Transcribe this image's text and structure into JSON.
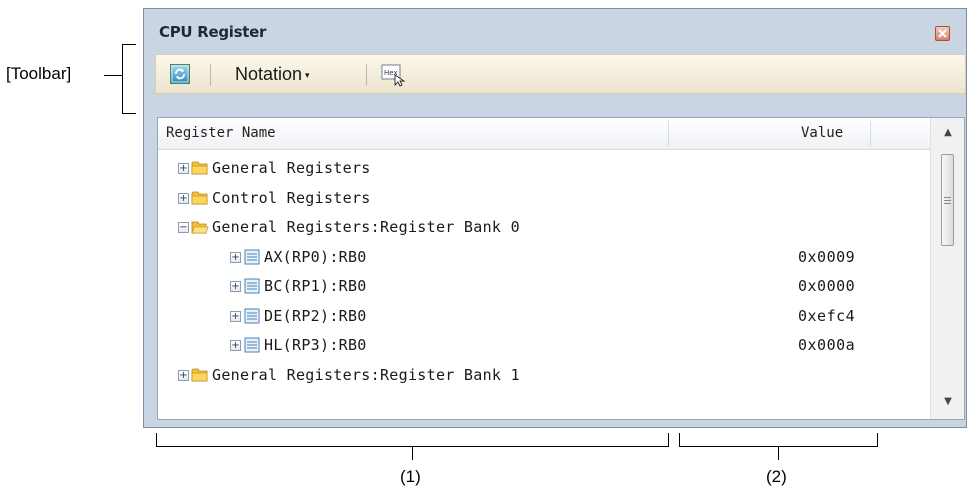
{
  "annotations": {
    "toolbar_label": "[Toolbar]",
    "column1_label": "(1)",
    "column2_label": "(2)"
  },
  "window": {
    "title": "CPU Register",
    "close_icon": "close-icon"
  },
  "toolbar": {
    "refresh_icon": "refresh-icon",
    "notation_label": "Notation",
    "notation_caret": "▾",
    "hex_icon": "hex-icon"
  },
  "table": {
    "columns": [
      "Register Name",
      "Value"
    ],
    "rows": [
      {
        "name": "General Registers",
        "value": "",
        "level": 0,
        "expander": "+",
        "icon": "folder-closed-icon"
      },
      {
        "name": "Control Registers",
        "value": "",
        "level": 0,
        "expander": "+",
        "icon": "folder-closed-icon"
      },
      {
        "name": "General Registers:Register Bank 0",
        "value": "",
        "level": 0,
        "expander": "−",
        "icon": "folder-open-icon"
      },
      {
        "name": "AX(RP0):RB0",
        "value": "0x0009",
        "level": 1,
        "expander": "+",
        "icon": "register-icon"
      },
      {
        "name": "BC(RP1):RB0",
        "value": "0x0000",
        "level": 1,
        "expander": "+",
        "icon": "register-icon"
      },
      {
        "name": "DE(RP2):RB0",
        "value": "0xefc4",
        "level": 1,
        "expander": "+",
        "icon": "register-icon"
      },
      {
        "name": "HL(RP3):RB0",
        "value": "0x000a",
        "level": 1,
        "expander": "+",
        "icon": "register-icon"
      },
      {
        "name": "General Registers:Register Bank 1",
        "value": "",
        "level": 0,
        "expander": "+",
        "icon": "folder-closed-icon"
      }
    ]
  },
  "scrollbar": {
    "up_arrow": "▲",
    "down_arrow": "▼"
  }
}
